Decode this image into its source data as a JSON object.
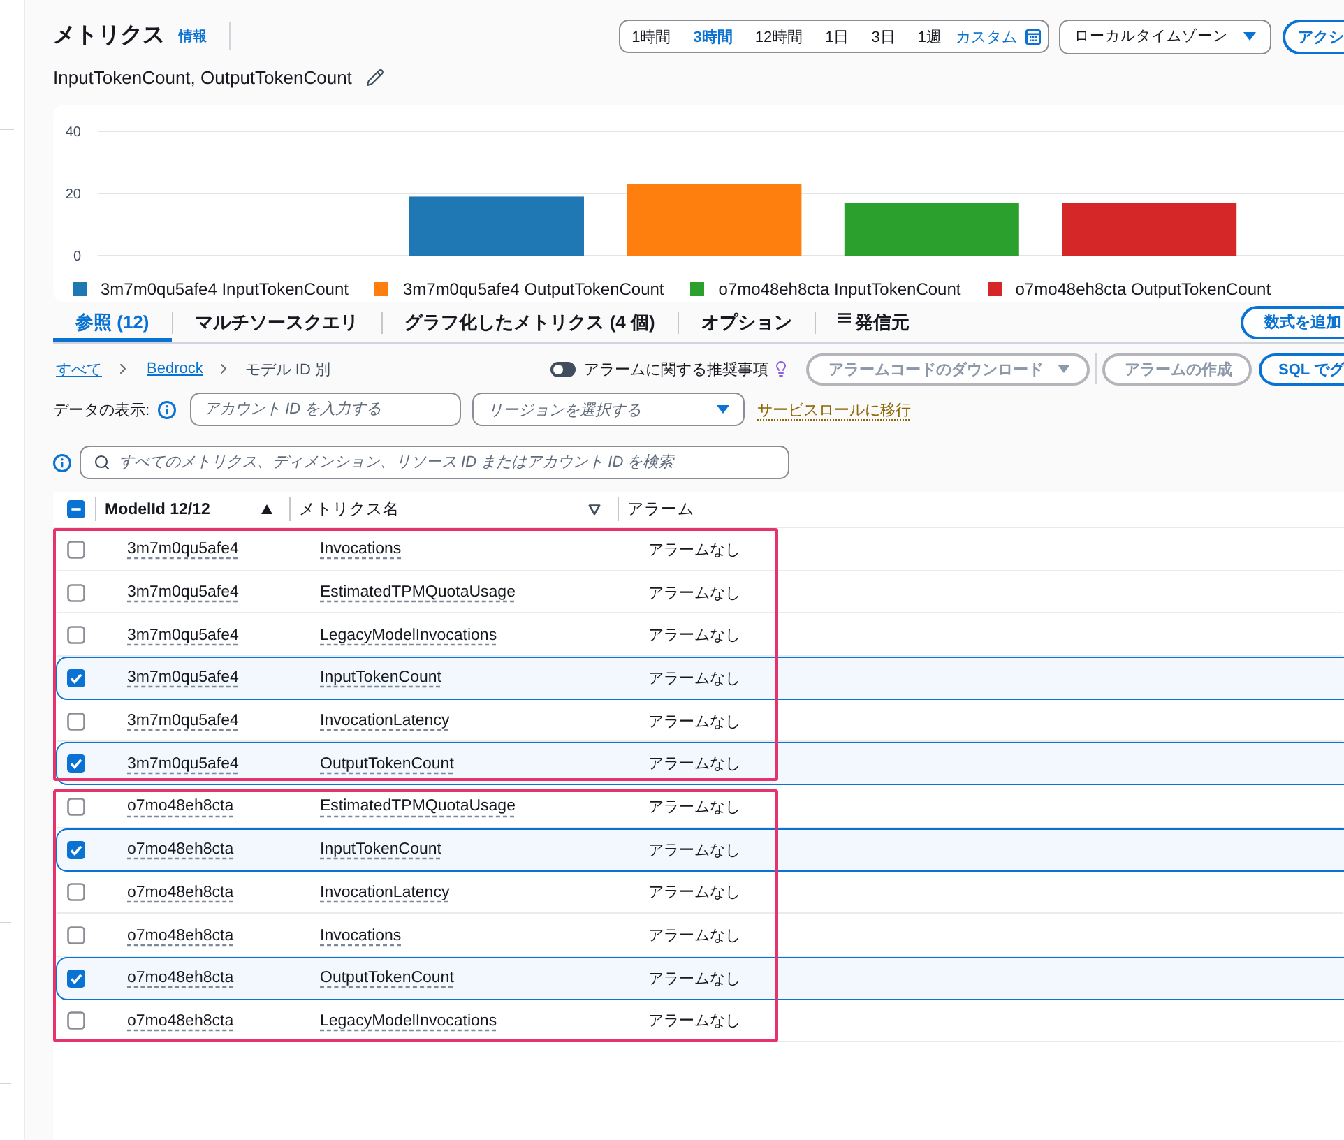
{
  "header": {
    "title": "メトリクス",
    "info_link": "情報",
    "time_ranges": [
      {
        "label": "1時間",
        "selected": false
      },
      {
        "label": "3時間",
        "selected": true
      },
      {
        "label": "12時間",
        "selected": false
      },
      {
        "label": "1日",
        "selected": false
      },
      {
        "label": "3日",
        "selected": false
      },
      {
        "label": "1週",
        "selected": false
      }
    ],
    "custom_range": "カスタム",
    "timezone": "ローカルタイムゾーン",
    "actions_button": "アクシ",
    "graph_title": "InputTokenCount, OutputTokenCount"
  },
  "chart": {
    "chart_data": {
      "type": "bar",
      "series": [
        {
          "name": "3m7m0qu5afe4 InputTokenCount",
          "color": "#1f77b4",
          "values": [
            19
          ]
        },
        {
          "name": "3m7m0qu5afe4 OutputTokenCount",
          "color": "#ff7f0e",
          "values": [
            23
          ]
        },
        {
          "name": "o7mo48eh8cta InputTokenCount",
          "color": "#2ca02c",
          "values": [
            17
          ]
        },
        {
          "name": "o7mo48eh8cta OutputTokenCount",
          "color": "#d62728",
          "values": [
            17
          ]
        }
      ],
      "ylim": [
        0,
        40
      ],
      "yticks": [
        0,
        20,
        40
      ],
      "legend": "bottom"
    }
  },
  "tabs": [
    {
      "label": "参照 (12)",
      "selected": true,
      "kind": "text"
    },
    {
      "label": "マルチソースクエリ",
      "selected": false,
      "kind": "text"
    },
    {
      "label": "グラフ化したメトリクス (4 個)",
      "selected": false,
      "kind": "text"
    },
    {
      "label": "オプション",
      "selected": false,
      "kind": "text"
    },
    {
      "label": "発信元",
      "selected": false,
      "kind": "icon"
    }
  ],
  "add_math_button": "数式を追加",
  "breadcrumb": [
    {
      "label": "すべて",
      "kind": "link"
    },
    {
      "label": "Bedrock",
      "kind": "link"
    },
    {
      "label": "モデル ID 別",
      "kind": "current"
    }
  ],
  "alarm_recommendations": {
    "label": "アラームに関する推奨事項",
    "on": false
  },
  "download_alarm_code_button": {
    "label": "アラームコードのダウンロード",
    "disabled": true
  },
  "create_alarm_button": {
    "label": "アラームの作成",
    "disabled": true
  },
  "sql_button": {
    "label": "SQL でグ",
    "disabled": false
  },
  "data_filter": {
    "label": "データの表示:",
    "account_id": {
      "placeholder": "アカウント ID を入力する"
    },
    "region": {
      "placeholder": "リージョンを選択する"
    },
    "service_role_link": "サービスロールに移行"
  },
  "search": {
    "placeholder": "すべてのメトリクス、ディメンション、リソース ID またはアカウント ID を検索"
  },
  "table": {
    "select_all": {
      "indeterminate": true
    },
    "columns": [
      {
        "label": "ModelId 12/12",
        "sortable": true,
        "sorted": true
      },
      {
        "label": "メトリクス名",
        "sortable": true,
        "sorted": false
      },
      {
        "label": "アラーム",
        "sortable": false
      }
    ],
    "groups": [
      {
        "rows": [
          {
            "model_id": "3m7m0qu5afe4",
            "metric": "Invocations",
            "alarm": "アラームなし",
            "selected": false
          },
          {
            "model_id": "3m7m0qu5afe4",
            "metric": "EstimatedTPMQuotaUsage",
            "alarm": "アラームなし",
            "selected": false
          },
          {
            "model_id": "3m7m0qu5afe4",
            "metric": "LegacyModelInvocations",
            "alarm": "アラームなし",
            "selected": false
          },
          {
            "model_id": "3m7m0qu5afe4",
            "metric": "InputTokenCount",
            "alarm": "アラームなし",
            "selected": true
          },
          {
            "model_id": "3m7m0qu5afe4",
            "metric": "InvocationLatency",
            "alarm": "アラームなし",
            "selected": false
          },
          {
            "model_id": "3m7m0qu5afe4",
            "metric": "OutputTokenCount",
            "alarm": "アラームなし",
            "selected": true
          }
        ]
      },
      {
        "rows": [
          {
            "model_id": "o7mo48eh8cta",
            "metric": "EstimatedTPMQuotaUsage",
            "alarm": "アラームなし",
            "selected": false
          },
          {
            "model_id": "o7mo48eh8cta",
            "metric": "InputTokenCount",
            "alarm": "アラームなし",
            "selected": true
          },
          {
            "model_id": "o7mo48eh8cta",
            "metric": "InvocationLatency",
            "alarm": "アラームなし",
            "selected": false
          },
          {
            "model_id": "o7mo48eh8cta",
            "metric": "Invocations",
            "alarm": "アラームなし",
            "selected": false
          },
          {
            "model_id": "o7mo48eh8cta",
            "metric": "OutputTokenCount",
            "alarm": "アラームなし",
            "selected": true
          },
          {
            "model_id": "o7mo48eh8cta",
            "metric": "LegacyModelInvocations",
            "alarm": "アラームなし",
            "selected": false
          }
        ]
      }
    ]
  }
}
